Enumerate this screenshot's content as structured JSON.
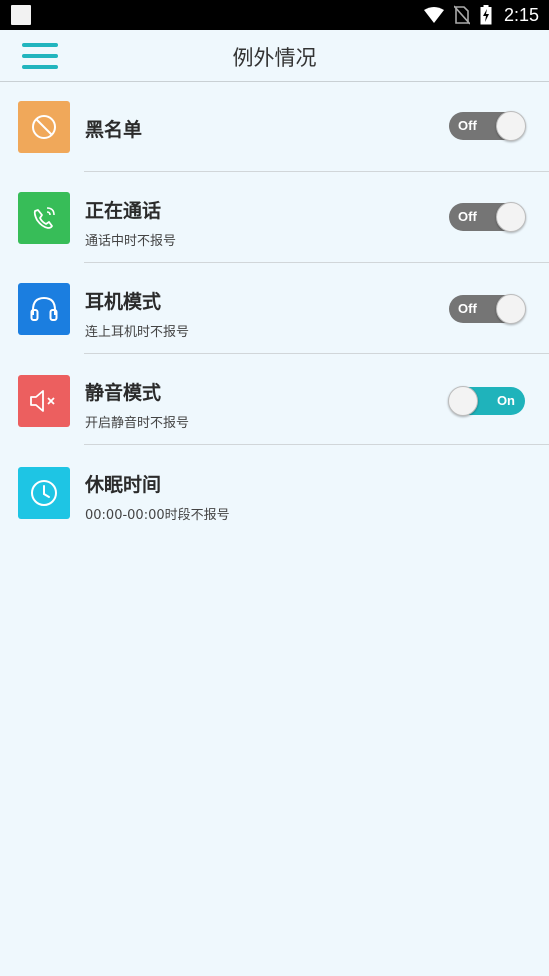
{
  "status_bar": {
    "time": "2:15",
    "icons": [
      "notification-square-icon",
      "wifi-icon",
      "no-sim-icon",
      "battery-charging-icon"
    ]
  },
  "header": {
    "title": "例外情况",
    "menu_icon": "hamburger-menu-icon"
  },
  "items": [
    {
      "title": "黑名单",
      "subtitle": "",
      "icon": "blocked-icon",
      "icon_color": "#f0a85a",
      "toggle": {
        "state": "off",
        "label": "Off"
      }
    },
    {
      "title": "正在通话",
      "subtitle": "通话中时不报号",
      "icon": "phone-call-icon",
      "icon_color": "#37bd58",
      "toggle": {
        "state": "off",
        "label": "Off"
      }
    },
    {
      "title": "耳机模式",
      "subtitle": "连上耳机时不报号",
      "icon": "headphones-icon",
      "icon_color": "#1b7ee0",
      "toggle": {
        "state": "off",
        "label": "Off"
      }
    },
    {
      "title": "静音模式",
      "subtitle": "开启静音时不报号",
      "icon": "mute-speaker-icon",
      "icon_color": "#ec5f5f",
      "toggle": {
        "state": "on",
        "label": "On"
      }
    },
    {
      "title": "休眠时间",
      "subtitle": "00:00-00:00时段不报号",
      "icon": "clock-icon",
      "icon_color": "#1ec5e4"
    }
  ],
  "colors": {
    "accent": "#1fb3bb",
    "toggle_off": "#757575",
    "background": "#eff8fd"
  }
}
